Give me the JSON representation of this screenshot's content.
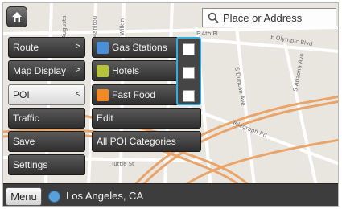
{
  "map": {
    "streets": [
      "Augusta",
      "Manitou",
      "Wilkin",
      "E 4th Pl",
      "E Olympic Blvd",
      "S Duncan Ave",
      "S Arizona Ave",
      "Telegraph Rd",
      "Tuttle St"
    ]
  },
  "header": {
    "home_icon": "home-icon",
    "search": {
      "placeholder": "Place or Address",
      "icon": "search-icon"
    }
  },
  "main_menu": {
    "items": [
      {
        "label": "Route",
        "arrow": ">"
      },
      {
        "label": "Map Display",
        "arrow": ">"
      },
      {
        "label": "POI",
        "arrow": "<"
      },
      {
        "label": "Traffic"
      },
      {
        "label": "Save"
      },
      {
        "label": "Settings"
      }
    ],
    "active": "POI"
  },
  "poi_menu": {
    "items": [
      {
        "label": "Gas Stations",
        "icon": "gas-station-icon",
        "icon_color": "#4a90d9",
        "checked": false
      },
      {
        "label": "Hotels",
        "icon": "hotel-icon",
        "icon_color": "#b7c43a",
        "checked": false
      },
      {
        "label": "Fast Food",
        "icon": "fast-food-icon",
        "icon_color": "#f08a24",
        "checked": false
      },
      {
        "label": "Edit"
      },
      {
        "label": "All POI Categories"
      }
    ]
  },
  "bottom_bar": {
    "menu_label": "Menu",
    "location": "Los Angeles, CA",
    "location_icon": "location-icon"
  },
  "colors": {
    "highlight": "#33aee0",
    "menu_dark": "#3a3a3a",
    "road_orange": "#e9a46a"
  }
}
